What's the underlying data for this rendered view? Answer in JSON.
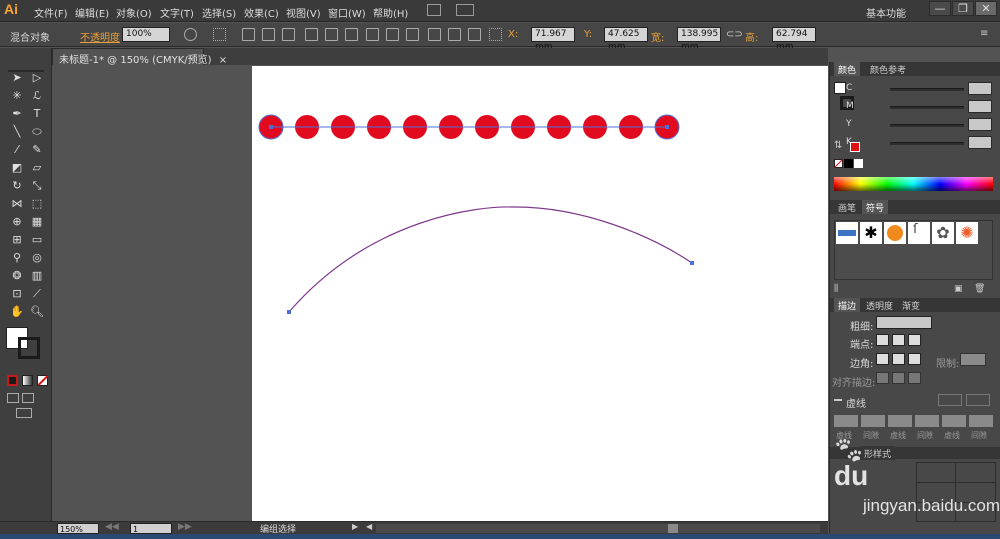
{
  "app": {
    "logo": "Ai"
  },
  "menu": [
    "文件(F)",
    "编辑(E)",
    "对象(O)",
    "文字(T)",
    "选择(S)",
    "效果(C)",
    "视图(V)",
    "窗口(W)",
    "帮助(H)"
  ],
  "workspace": "基本功能",
  "window_controls": {
    "minimize": "—",
    "restore": "❐",
    "close": "✕"
  },
  "control_bar": {
    "object_type": "混合对象",
    "opacity_label": "不透明度",
    "opacity_value": "100%",
    "x_label": "X:",
    "x_value": "71.967 mm",
    "y_label": "Y:",
    "y_value": "47.625 mm",
    "w_label": "宽:",
    "w_value": "138.995 mm",
    "h_label": "高:",
    "h_value": "62.794 mm"
  },
  "document": {
    "tab_title": "未标题-1* @ 150% (CMYK/预览)",
    "close": "×"
  },
  "panels": {
    "color_tabs": [
      "颜色",
      "颜色参考"
    ],
    "cmyk": [
      {
        "label": "C",
        "value": ""
      },
      {
        "label": "M",
        "value": ""
      },
      {
        "label": "Y",
        "value": ""
      },
      {
        "label": "K",
        "value": ""
      }
    ],
    "brush_tabs": [
      "画笔",
      "符号"
    ],
    "stroke_tabs": [
      "描边",
      "透明度",
      "渐变"
    ],
    "stroke": {
      "weight_label": "粗细:",
      "cap_label": "端点:",
      "corner_label": "边角:",
      "limit_label": "限制:",
      "align_label": "对齐描边:",
      "dashed_label": "虚线",
      "dash_labels": [
        "虚线",
        "间隙",
        "虚线",
        "间隙",
        "虚线",
        "间隙"
      ]
    },
    "graphic_styles_partial": [
      "形样式"
    ]
  },
  "status_bar": {
    "zoom": "150%",
    "page": "1",
    "mode": "编组选择"
  },
  "watermark": {
    "text": "du",
    "domain": "jingyan.baidu.com"
  },
  "colors": {
    "accent_orange": "#f7a434",
    "dot_red": "#e10a1e",
    "path_purple": "#7e3a8c",
    "selection_blue": "#4f6fd8"
  }
}
